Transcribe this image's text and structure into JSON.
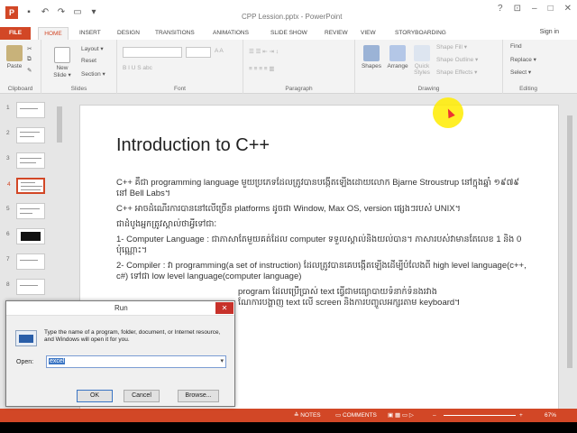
{
  "window": {
    "title": "CPP Lession.pptx - PowerPoint",
    "minimize": "–",
    "maximize": "□",
    "close": "✕",
    "help": "?",
    "restore_ribbon": "⊡"
  },
  "qat": {
    "logo": "P",
    "save": "▪",
    "undo": "↶",
    "redo": "↷",
    "start": "▭",
    "more": "▾"
  },
  "tabs": [
    "FILE",
    "HOME",
    "INSERT",
    "DESIGN",
    "TRANSITIONS",
    "ANIMATIONS",
    "SLIDE SHOW",
    "REVIEW",
    "VIEW",
    "STORYBOARDING"
  ],
  "active_tab": "HOME",
  "sign_in": "Sign in",
  "ribbon": {
    "clipboard": {
      "label": "Clipboard",
      "paste": "Paste"
    },
    "slides": {
      "label": "Slides",
      "new_slide": "New Slide ▾",
      "layout": "Layout ▾",
      "reset": "Reset",
      "section": "Section ▾"
    },
    "font": {
      "label": "Font"
    },
    "paragraph": {
      "label": "Paragraph"
    },
    "drawing": {
      "label": "Drawing",
      "shapes": "Shapes",
      "arrange": "Arrange",
      "quick_styles": "Quick Styles",
      "shape_fill": "Shape Fill ▾",
      "shape_outline": "Shape Outline ▾",
      "shape_effects": "Shape Effects ▾"
    },
    "editing": {
      "label": "Editing",
      "find": "Find",
      "replace": "Replace ▾",
      "select": "Select ▾"
    }
  },
  "thumbnails": [
    "1",
    "2",
    "3",
    "4",
    "5",
    "6",
    "7",
    "8"
  ],
  "selected_thumbnail": "4",
  "slide": {
    "title": "Introduction to C++",
    "paragraphs": [
      "C++ គឺជា programming language មួយប្រភេទដែលត្រូវបានបង្កើតឡើងដោយលោក Bjarne Stroustrup នៅក្នុងឆ្នាំ ១៩៧៩ នៅ Bell Labs។",
      "C++ អាចដំណើរការបាននៅលើច្រើន platforms ដូចជា Window, Max OS, version ផ្សេងៗរបស់ UNIX។",
      "ជាដំបូងអ្នកត្រូវស្គាល់ថាអ្វីទៅជាៈ",
      "1- Computer Language : ជាភាសាតែមួយគត់ដែល computer ទទួលស្គាល់និងយល់បាន។ ភាសារបស់វាមានតែលេខ 1 និង 0 ប៉ុណ្ណោះ។",
      "2- Compiler : វា programming(a set of instruction) ដែលត្រូវបានគេបង្កើតឡើងដើម្បីបំលែងពី high level language(c++, c#) ទៅជា low level language(computer language)",
      "program ដែលប្រើប្រាស់ text ធ្វើជាមធ្យោបាយទំនាក់ទំនងរវាង",
      "ណែការបង្ហាញ text លើ screen និងការបញ្ចូលអក្សរតាម keyboard។"
    ]
  },
  "status": {
    "notes": "≙ NOTES",
    "comments": "▭ COMMENTS",
    "zoom": "67%",
    "zoom_minus": "–",
    "zoom_plus": "+"
  },
  "run_dialog": {
    "title": "Run",
    "close": "✕",
    "description": "Type the name of a program, folder, document, or Internet resource, and Windows will open it for you.",
    "open_label": "Open:",
    "open_value": "excel",
    "dropdown": "▾",
    "ok": "OK",
    "cancel": "Cancel",
    "browse": "Browse..."
  },
  "colors": {
    "accent": "#d24726",
    "dialog_close": "#c7312a",
    "cursor_highlight": "#ffec00"
  }
}
